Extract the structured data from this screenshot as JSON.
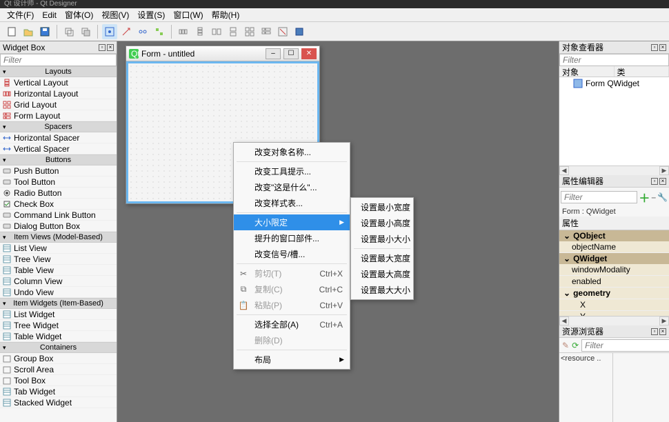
{
  "titlebar": "Qt 设计师 - Qt Designer",
  "menubar": [
    "文件(F)",
    "Edit",
    "窗体(O)",
    "视图(V)",
    "设置(S)",
    "窗口(W)",
    "帮助(H)"
  ],
  "widgetbox": {
    "title": "Widget Box",
    "filter_placeholder": "Filter",
    "sections": [
      {
        "name": "Layouts",
        "items": [
          "Vertical Layout",
          "Horizontal Layout",
          "Grid Layout",
          "Form Layout"
        ]
      },
      {
        "name": "Spacers",
        "items": [
          "Horizontal Spacer",
          "Vertical Spacer"
        ]
      },
      {
        "name": "Buttons",
        "items": [
          "Push Button",
          "Tool Button",
          "Radio Button",
          "Check Box",
          "Command Link Button",
          "Dialog Button Box"
        ]
      },
      {
        "name": "Item Views (Model-Based)",
        "items": [
          "List View",
          "Tree View",
          "Table View",
          "Column View",
          "Undo View"
        ]
      },
      {
        "name": "Item Widgets (Item-Based)",
        "items": [
          "List Widget",
          "Tree Widget",
          "Table Widget"
        ]
      },
      {
        "name": "Containers",
        "items": [
          "Group Box",
          "Scroll Area",
          "Tool Box",
          "Tab Widget",
          "Stacked Widget"
        ]
      }
    ]
  },
  "form": {
    "title": "Form - untitled"
  },
  "context_menu": {
    "items": [
      {
        "label": "改变对象名称...",
        "type": "item"
      },
      {
        "type": "sep"
      },
      {
        "label": "改变工具提示...",
        "type": "item"
      },
      {
        "label": "改变\"这是什么\"...",
        "type": "item"
      },
      {
        "label": "改变样式表...",
        "type": "item"
      },
      {
        "type": "sep"
      },
      {
        "label": "大小限定",
        "type": "submenu",
        "highlight": true
      },
      {
        "label": "提升的窗口部件...",
        "type": "item"
      },
      {
        "label": "改变信号/槽...",
        "type": "item"
      },
      {
        "type": "sep"
      },
      {
        "label": "剪切(T)",
        "shortcut": "Ctrl+X",
        "icon": "cut",
        "type": "item",
        "disabled": true
      },
      {
        "label": "复制(C)",
        "shortcut": "Ctrl+C",
        "icon": "copy",
        "type": "item",
        "disabled": true
      },
      {
        "label": "粘贴(P)",
        "shortcut": "Ctrl+V",
        "icon": "paste",
        "type": "item",
        "disabled": true
      },
      {
        "type": "sep"
      },
      {
        "label": "选择全部(A)",
        "shortcut": "Ctrl+A",
        "type": "item"
      },
      {
        "label": "删除(D)",
        "type": "item",
        "disabled": true
      },
      {
        "type": "sep"
      },
      {
        "label": "布局",
        "type": "submenu"
      }
    ],
    "submenu": [
      "设置最小宽度",
      "设置最小高度",
      "设置最小大小",
      "",
      "设置最大宽度",
      "设置最大高度",
      "设置最大大小"
    ]
  },
  "object_inspector": {
    "title": "对象查看器",
    "filter_placeholder": "Filter",
    "columns": [
      "对象",
      "类"
    ],
    "root": "Form QWidget"
  },
  "property_editor": {
    "title": "属性编辑器",
    "filter_placeholder": "Filter",
    "header": "Form : QWidget",
    "col": "属性",
    "groups": [
      {
        "name": "QObject",
        "rows": [
          "objectName"
        ]
      },
      {
        "name": "QWidget",
        "rows": [
          "windowModality",
          "enabled"
        ],
        "geometry": {
          "name": "geometry",
          "sub": [
            "X",
            "Y"
          ]
        }
      }
    ]
  },
  "resource_browser": {
    "title": "资源浏览器",
    "filter_placeholder": "Filter",
    "root": "<resource .."
  }
}
